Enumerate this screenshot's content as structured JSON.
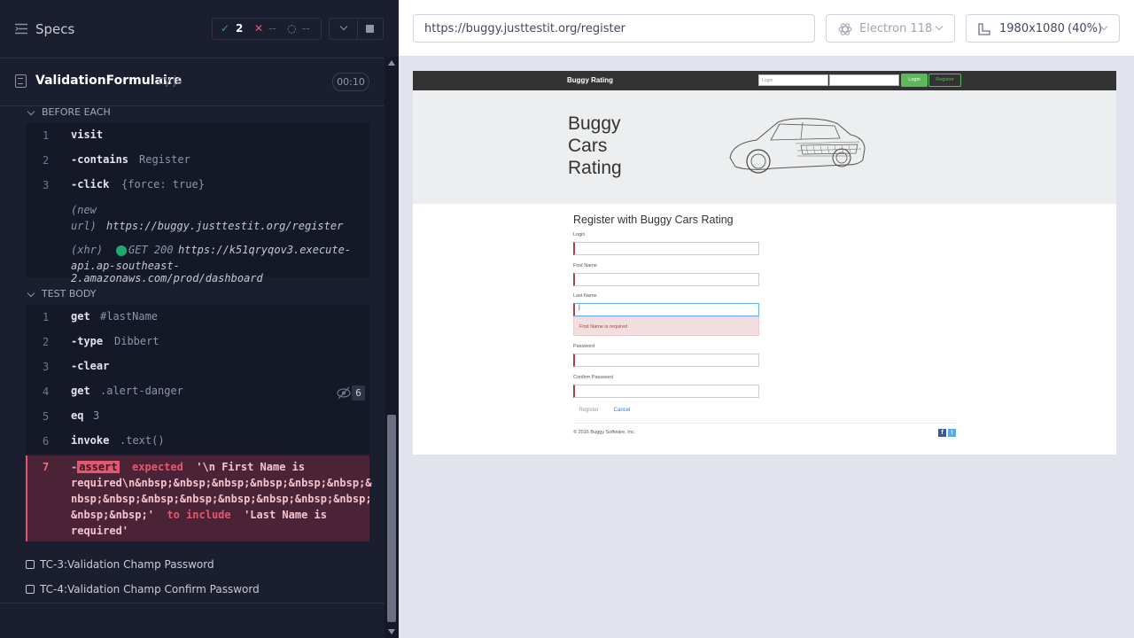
{
  "runner": {
    "specs_label": "Specs",
    "passed": "2",
    "failed": "--",
    "pending": "--",
    "file_name": "ValidationFormulaire",
    "file_ext": ".cy.js",
    "duration": "00:10"
  },
  "before_each": {
    "title": "BEFORE EACH",
    "commands": [
      {
        "num": "1",
        "name": "visit",
        "msg": ""
      },
      {
        "num": "2",
        "name": "-contains",
        "msg": "Register"
      },
      {
        "num": "3",
        "name": "-click",
        "msg": "{force: true}"
      }
    ],
    "new_url_label_1": "(new",
    "new_url_label_2": "url)",
    "new_url": "https://buggy.justtestit.org/register",
    "xhr_label": "(xhr)",
    "xhr_method": "GET 200",
    "xhr_url_1": "https://k51qryqov3.execute-",
    "xhr_url_2": "api.ap-southeast-2.amazonaws.com/prod/dashboard"
  },
  "test_body": {
    "title": "TEST BODY",
    "commands": [
      {
        "num": "1",
        "name": "get",
        "msg": "#lastName"
      },
      {
        "num": "2",
        "name": "-type",
        "msg": "Dibbert"
      },
      {
        "num": "3",
        "name": "-clear",
        "msg": ""
      },
      {
        "num": "4",
        "name": "get",
        "msg": ".alert-danger"
      },
      {
        "num": "5",
        "name": "eq",
        "msg": "3"
      },
      {
        "num": "6",
        "name": "invoke",
        "msg": ".text()"
      }
    ],
    "hidden_count": "6",
    "failed": {
      "num": "7",
      "dash": "-",
      "chip": "assert",
      "expected_kw": "expected",
      "actual_1": "'\\n First Name is",
      "actual_2": "required\\n&nbsp;&nbsp;&nbsp;&nbsp;&nbsp;&nbsp;&",
      "actual_3": "nbsp;&nbsp;&nbsp;&nbsp;&nbsp;&nbsp;&nbsp;&nbsp;",
      "actual_4": "&nbsp;&nbsp;'",
      "include_kw": "to include",
      "expected_1": "'Last Name is",
      "expected_2": "required'"
    }
  },
  "tests": [
    {
      "label": "TC-3:Validation Champ Password"
    },
    {
      "label": "TC-4:Validation Champ Confirm Password"
    }
  ],
  "browser": {
    "url": "https://buggy.justtestit.org/register",
    "name": "Electron 118",
    "viewport": "1980x1080",
    "zoom": "(40%)"
  },
  "aut": {
    "brand": "Buggy Rating",
    "login_placeholder": "Login",
    "login_button": "Login",
    "register_button": "Register",
    "hero_title": "Buggy Cars Rating",
    "form_title": "Register with Buggy Cars Rating",
    "label_login": "Login",
    "label_first_name": "First Name",
    "label_last_name": "Last Name",
    "last_name_value": "|",
    "alert_text": "First Name is required",
    "label_password": "Password",
    "label_confirm": "Confirm Password",
    "btn_register": "Register",
    "btn_cancel": "Cancel",
    "footer": "© 2016 Buggy Software, Inc."
  },
  "colors": {
    "pass": "#1fa971",
    "fail": "#e45770",
    "aut_nav": "#333333",
    "aut_success": "#5cb85c"
  }
}
